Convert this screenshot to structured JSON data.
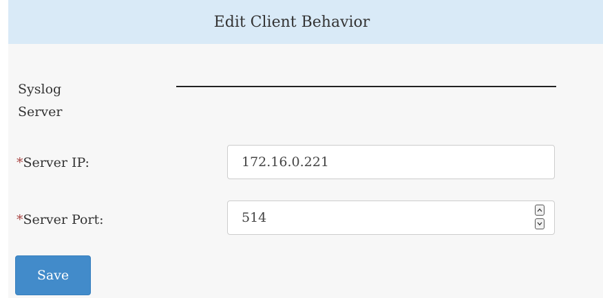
{
  "panel": {
    "title": "Edit Client Behavior"
  },
  "section": {
    "label": "Syslog Server"
  },
  "fields": {
    "server_ip": {
      "required_mark": "*",
      "label": "Server IP:",
      "value": "172.16.0.221"
    },
    "server_port": {
      "required_mark": "*",
      "label": "Server Port:",
      "value": "514"
    }
  },
  "actions": {
    "save_label": "Save"
  },
  "colors": {
    "header_bg": "#d9eaf7",
    "panel_bg": "#f7f7f7",
    "required": "#a94442",
    "primary_button": "#428bca"
  },
  "icons": {
    "spin_up": "chevron-up-icon",
    "spin_down": "chevron-down-icon"
  }
}
